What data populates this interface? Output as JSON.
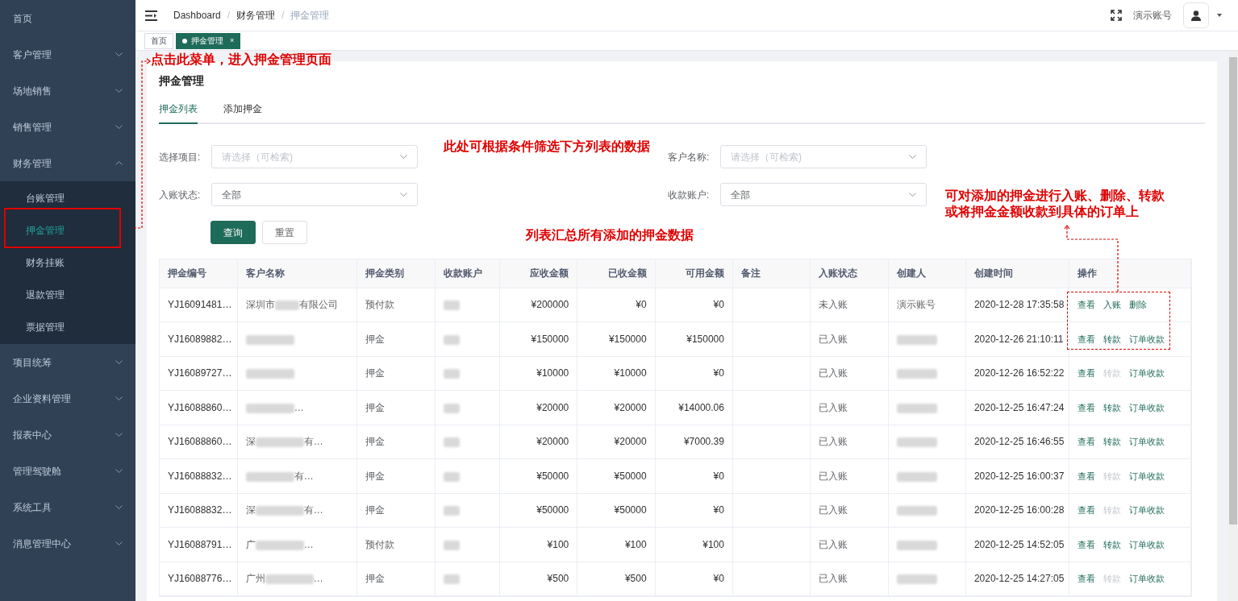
{
  "sidebar": {
    "items": [
      {
        "label": "首页",
        "selected": false
      },
      {
        "label": "客户管理",
        "expanded": false,
        "selected": false
      },
      {
        "label": "场地销售",
        "expanded": false,
        "selected": false
      },
      {
        "label": "销售管理",
        "expanded": false,
        "selected": false
      },
      {
        "label": "财务管理",
        "expanded": true,
        "selected": false,
        "children": [
          {
            "label": "台账管理",
            "selected": false
          },
          {
            "label": "押金管理",
            "selected": true
          },
          {
            "label": "财务挂账",
            "selected": false
          },
          {
            "label": "退款管理",
            "selected": false
          },
          {
            "label": "票据管理",
            "selected": false
          }
        ]
      },
      {
        "label": "项目统筹",
        "expanded": false,
        "selected": false
      },
      {
        "label": "企业资料管理",
        "expanded": false,
        "selected": false
      },
      {
        "label": "报表中心",
        "expanded": false,
        "selected": false
      },
      {
        "label": "管理驾驶舱",
        "expanded": false,
        "selected": false
      },
      {
        "label": "系统工具",
        "expanded": false,
        "selected": false
      },
      {
        "label": "消息管理中心",
        "expanded": false,
        "selected": false
      }
    ]
  },
  "breadcrumb": [
    {
      "kind": "link",
      "label": "Dashboard"
    },
    {
      "kind": "separator",
      "label": "/"
    },
    {
      "kind": "link",
      "label": "财务管理"
    },
    {
      "kind": "separator",
      "label": "/"
    },
    {
      "kind": "current",
      "label": "押金管理"
    }
  ],
  "user": {
    "name": "演示账号"
  },
  "page_tabs": [
    {
      "label": "首页",
      "selected": false
    },
    {
      "label": "押金管理",
      "selected": true,
      "closable": "×"
    }
  ],
  "card": {
    "title": "押金管理",
    "tabs": [
      {
        "label": "押金列表",
        "selected": true
      },
      {
        "label": "添加押金",
        "selected": false
      }
    ],
    "filters": [
      {
        "label": "选择项目:",
        "placeholder": "请选择（可检索)"
      },
      {
        "label": "客户名称:",
        "placeholder": "请选择（可检索)"
      },
      {
        "label": "入账状态:",
        "value": "全部"
      },
      {
        "label": "收款账户:",
        "value": "全部"
      }
    ],
    "buttons": [
      {
        "label": "查询",
        "kind": "primary"
      },
      {
        "label": "重置",
        "kind": "default"
      }
    ]
  },
  "table": {
    "columns": [
      "押金编号",
      "客户名称",
      "押金类别",
      "收款账户",
      "应收金额",
      "已收金额",
      "可用金额",
      "备注",
      "入账状态",
      "创建人",
      "创建时间",
      "操作"
    ],
    "rows": [
      {
        "id": "YJ16091481…",
        "customer": {
          "prefix": "深圳市",
          "suffix": "有限公司"
        },
        "category": "预付款",
        "receivable": "¥200000",
        "received": "¥0",
        "available": "¥0",
        "status": "未入账",
        "creator": "演示账号",
        "created": "2020-12-28 17:35:58",
        "actions": [
          {
            "label": "查看",
            "disabled": false
          },
          {
            "label": "入账",
            "disabled": false
          },
          {
            "label": "删除",
            "disabled": false
          }
        ]
      },
      {
        "id": "YJ16089882…",
        "customer": {},
        "category": "押金",
        "receivable": "¥150000",
        "received": "¥150000",
        "available": "¥150000",
        "status": "已入账",
        "created": "2020-12-26 21:10:11",
        "actions": [
          {
            "label": "查看",
            "disabled": false
          },
          {
            "label": "转款",
            "disabled": false
          },
          {
            "label": "订单收款",
            "disabled": false
          }
        ]
      },
      {
        "id": "YJ16089727…",
        "customer": {},
        "category": "押金",
        "receivable": "¥10000",
        "received": "¥10000",
        "available": "¥0",
        "status": "已入账",
        "created": "2020-12-26 16:52:22",
        "actions": [
          {
            "label": "查看",
            "disabled": false
          },
          {
            "label": "转款",
            "disabled": true
          },
          {
            "label": "订单收款",
            "disabled": false
          }
        ]
      },
      {
        "id": "YJ16088860…",
        "customer": {
          "suffix": "…"
        },
        "category": "押金",
        "receivable": "¥20000",
        "received": "¥20000",
        "available": "¥14000.06",
        "status": "已入账",
        "created": "2020-12-25 16:47:24",
        "actions": [
          {
            "label": "查看",
            "disabled": false
          },
          {
            "label": "转款",
            "disabled": false
          },
          {
            "label": "订单收款",
            "disabled": false
          }
        ]
      },
      {
        "id": "YJ16088860…",
        "customer": {
          "prefix": "深",
          "suffix": "有…"
        },
        "category": "押金",
        "receivable": "¥20000",
        "received": "¥20000",
        "available": "¥7000.39",
        "status": "已入账",
        "created": "2020-12-25 16:46:55",
        "actions": [
          {
            "label": "查看",
            "disabled": false
          },
          {
            "label": "转款",
            "disabled": false
          },
          {
            "label": "订单收款",
            "disabled": false
          }
        ]
      },
      {
        "id": "YJ16088832…",
        "customer": {
          "suffix": "有…"
        },
        "category": "押金",
        "receivable": "¥50000",
        "received": "¥50000",
        "available": "¥0",
        "status": "已入账",
        "created": "2020-12-25 16:00:37",
        "actions": [
          {
            "label": "查看",
            "disabled": false
          },
          {
            "label": "转款",
            "disabled": true
          },
          {
            "label": "订单收款",
            "disabled": false
          }
        ]
      },
      {
        "id": "YJ16088832…",
        "customer": {
          "prefix": "深",
          "suffix": "有…"
        },
        "category": "押金",
        "receivable": "¥50000",
        "received": "¥50000",
        "available": "¥0",
        "status": "已入账",
        "created": "2020-12-25 16:00:28",
        "actions": [
          {
            "label": "查看",
            "disabled": false
          },
          {
            "label": "转款",
            "disabled": true
          },
          {
            "label": "订单收款",
            "disabled": false
          }
        ]
      },
      {
        "id": "YJ16088791…",
        "customer": {
          "prefix": "广",
          "suffix": "…"
        },
        "category": "预付款",
        "receivable": "¥100",
        "received": "¥100",
        "available": "¥100",
        "status": "已入账",
        "created": "2020-12-25 14:52:05",
        "actions": [
          {
            "label": "查看",
            "disabled": false
          },
          {
            "label": "转款",
            "disabled": false
          },
          {
            "label": "订单收款",
            "disabled": false
          }
        ]
      },
      {
        "id": "YJ16088776…",
        "customer": {
          "prefix": "广州",
          "suffix": "…"
        },
        "category": "押金",
        "receivable": "¥500",
        "received": "¥500",
        "available": "¥0",
        "status": "已入账",
        "created": "2020-12-25 14:27:05",
        "actions": [
          {
            "label": "查看",
            "disabled": false
          },
          {
            "label": "转款",
            "disabled": true
          },
          {
            "label": "订单收款",
            "disabled": false
          }
        ]
      }
    ]
  },
  "annotations": [
    {
      "kind": "menu",
      "text": "点击此菜单，进入押金管理页面"
    },
    {
      "kind": "filter",
      "text": "此处可根据条件筛选下方列表的数据"
    },
    {
      "kind": "list",
      "text": "列表汇总所有添加的押金数据"
    },
    {
      "kind": "actions",
      "text": "可对添加的押金进行入账、删除、转款"
    },
    {
      "kind": "actions2",
      "text": "或将押金金额收款到具体的订单上"
    }
  ]
}
